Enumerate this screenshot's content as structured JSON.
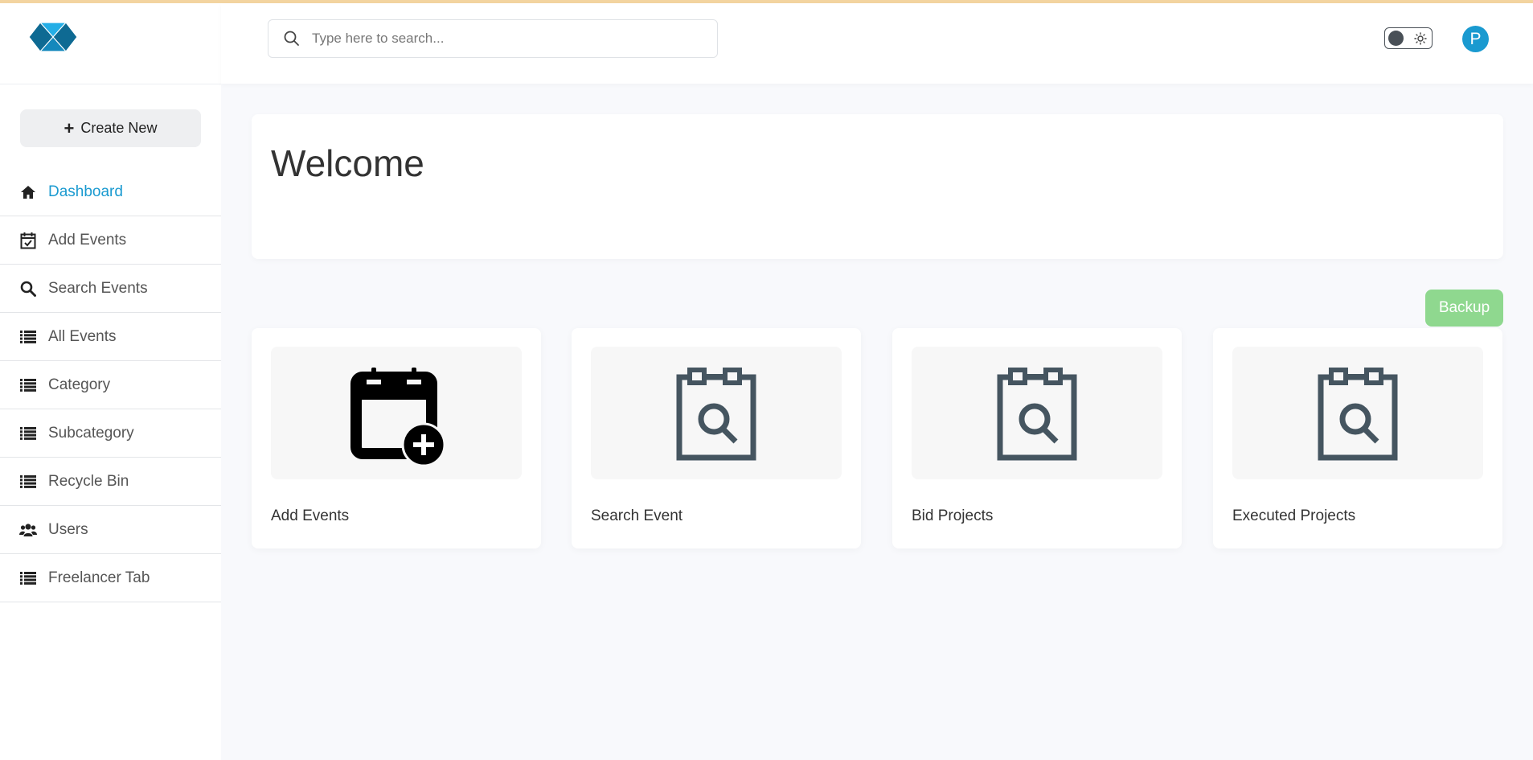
{
  "search": {
    "placeholder": "Type here to search..."
  },
  "header": {
    "avatar_initial": "P"
  },
  "sidebar": {
    "create_label": "Create New",
    "items": [
      {
        "label": "Dashboard",
        "icon": "home-icon",
        "active": true
      },
      {
        "label": "Add Events",
        "icon": "calendar-check-icon"
      },
      {
        "label": "Search Events",
        "icon": "search-icon"
      },
      {
        "label": "All Events",
        "icon": "list-icon"
      },
      {
        "label": "Category",
        "icon": "list-icon"
      },
      {
        "label": "Subcategory",
        "icon": "list-icon"
      },
      {
        "label": "Recycle Bin",
        "icon": "list-icon"
      },
      {
        "label": "Users",
        "icon": "users-icon"
      },
      {
        "label": "Freelancer Tab",
        "icon": "list-icon"
      }
    ]
  },
  "main": {
    "welcome": "Welcome",
    "backup_label": "Backup",
    "cards": [
      {
        "title": "Add Events",
        "icon": "calendar-plus-icon"
      },
      {
        "title": "Search Event",
        "icon": "calendar-search-icon"
      },
      {
        "title": "Bid Projects",
        "icon": "calendar-search-icon"
      },
      {
        "title": "Executed Projects",
        "icon": "calendar-search-icon"
      }
    ]
  },
  "colors": {
    "accent": "#1a9ad0",
    "backup": "#8fd88f",
    "icon_slate": "#455560"
  }
}
